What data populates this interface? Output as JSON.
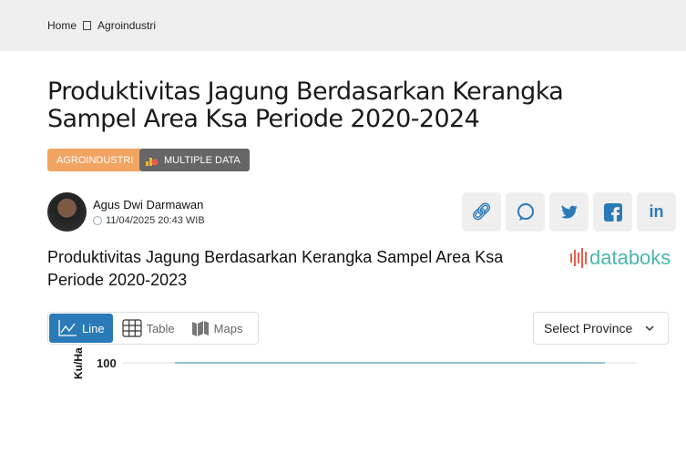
{
  "breadcrumb": {
    "home": "Home",
    "current": "Agroindustri"
  },
  "title": "Produktivitas Jagung Berdasarkan Kerangka Sampel Area Ksa Periode 2020-2024",
  "badges": {
    "category": "AGROINDUSTRI",
    "multiple": "MULTIPLE DATA"
  },
  "author": {
    "name": "Agus Dwi Darmawan",
    "date": "11/04/2025 20:43 WIB"
  },
  "share": [
    "link-icon",
    "whatsapp-icon",
    "twitter-icon",
    "facebook-icon",
    "linkedin-icon"
  ],
  "chart_title": "Produktivitas Jagung Berdasarkan Kerangka Sampel Area Ksa Periode 2020-2023",
  "logo": "databoks",
  "view_tabs": {
    "line": "Line",
    "table": "Table",
    "maps": "Maps"
  },
  "province_select": "Select Province",
  "colors": {
    "accent": "#2a7ab8",
    "category": "#f2a463",
    "line": "#6fb3bf"
  },
  "chart_data": {
    "type": "line",
    "ylabel": "Ku/Ha",
    "yticks": [
      "100"
    ],
    "series": [
      {
        "values": [
          100,
          100
        ]
      }
    ],
    "grid": true
  }
}
